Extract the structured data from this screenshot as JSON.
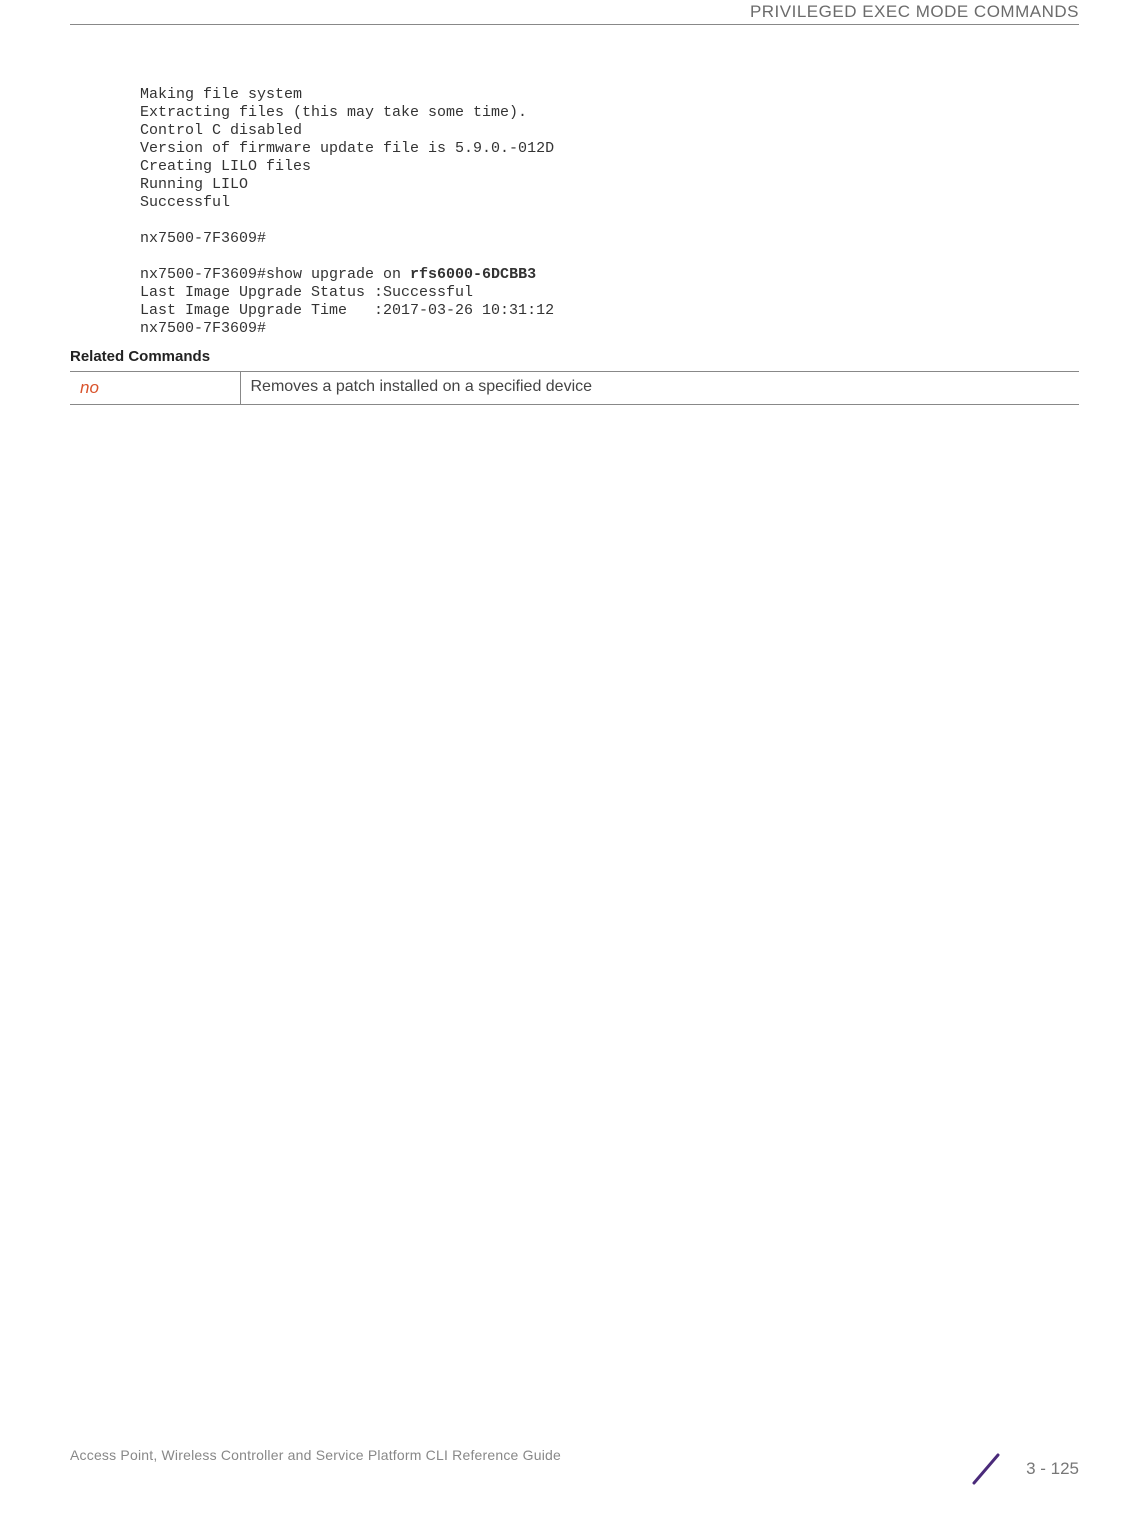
{
  "header": {
    "title": "PRIVILEGED EXEC MODE COMMANDS"
  },
  "code": {
    "line1": "Making file system",
    "line2": "Extracting files (this may take some time).",
    "line3": "Control C disabled",
    "line4": "Version of firmware update file is 5.9.0.-012D",
    "line5": "Creating LILO files",
    "line6": "Running LILO",
    "line7": "Successful",
    "blank1": "",
    "line8": "nx7500-7F3609#",
    "blank2": "",
    "line9a": "nx7500-7F3609#show upgrade on ",
    "line9b": "rfs6000-6DCBB3",
    "line10": "Last Image Upgrade Status :Successful",
    "line11": "Last Image Upgrade Time   :2017-03-26 10:31:12",
    "line12": "nx7500-7F3609#"
  },
  "related_commands": {
    "heading": "Related Commands",
    "rows": [
      {
        "command": "no",
        "description": "Removes a patch installed on a specified device"
      }
    ]
  },
  "footer": {
    "text": "Access Point, Wireless Controller and Service Platform CLI Reference Guide",
    "page": "3 - 125"
  }
}
